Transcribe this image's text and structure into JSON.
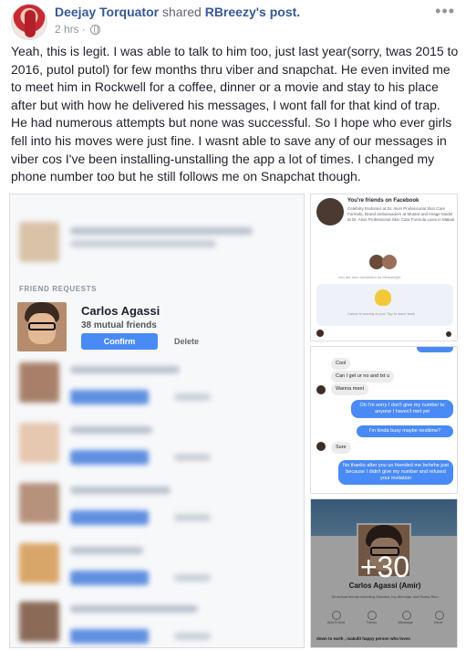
{
  "post": {
    "author": "Deejay Torquator",
    "shared_text": "shared",
    "shared_source": "RBreezy's post.",
    "time": "2 hrs",
    "separator": "·",
    "body": "Yeah, this is legit. I was able to talk to him too, just last year(sorry, twas 2015 to 2016, putol putol) for few months thru viber and snapchat. He even invited me to meet him in Rockwell for a coffee, dinner or a movie and stay to his place after but with how he delivered his messages, I wont fall for that kind of trap. He had numerous attempts but none was successful. So I hope who ever girls fell into his moves were just fine. I wasnt able to save any of our messages in viber cos I've been installing-unstalling the app a lot of times. I changed my phone number too but he still follows me on Snapchat though."
  },
  "photo_main": {
    "section_label": "FRIEND REQUESTS",
    "request_name": "Carlos Agassi",
    "request_mutual": "38 mutual friends",
    "confirm_label": "Confirm",
    "delete_label": "Delete"
  },
  "photo_2": {
    "title": "You're friends on Facebook",
    "description": "Celebrity Endorser at Dr. Alvin Professional Skin Care Formula, Brand ambassadors at Mutant and Image Model at Dr. Alvin Professional Skin Care Formula Lives in Makati",
    "connected": "You are now connected on Messenger",
    "wave_text": "Carlos is waving at you! Tap to wave back"
  },
  "photo_3": {
    "messages": [
      {
        "side": "in",
        "text": "Cool"
      },
      {
        "side": "in",
        "text": "Can I get ur no and txt u"
      },
      {
        "side": "in",
        "text": "Wanna meet"
      },
      {
        "side": "out",
        "text": "Oh I'm sorry I don't give my number to anyone I haven't met yet"
      },
      {
        "side": "out",
        "text": "I'm kinda busy maybe nexttime?"
      },
      {
        "side": "in",
        "text": "Sure"
      },
      {
        "side": "out",
        "text": "No thanks after you un friended me hehehe just because I didn't give my number and refused your invitation"
      }
    ]
  },
  "photo_4": {
    "name": "Carlos Agassi (Amir)",
    "subtitle": "38 mutual friends including Sandara Joy Abenojar and Rocky Rico",
    "actions": [
      "Add Friend",
      "Follow",
      "Message",
      "More"
    ],
    "bio": "down to earth , makulit happy person who loves",
    "more_count": "+30"
  },
  "colors": {
    "link": "#365899",
    "muted": "#90949c",
    "accent": "#4a8af4"
  }
}
